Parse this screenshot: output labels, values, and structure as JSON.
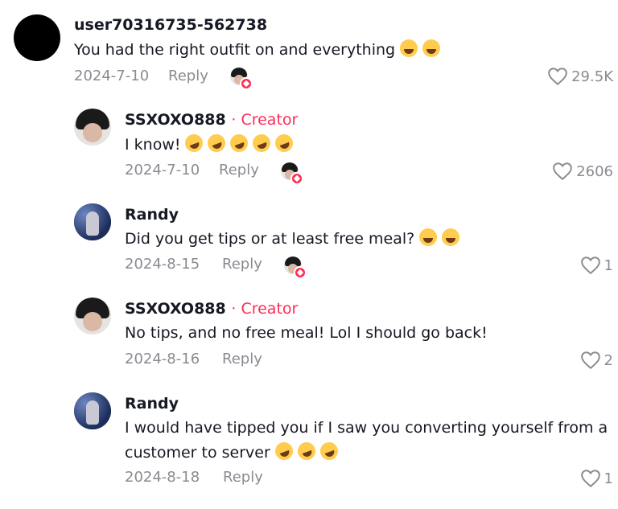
{
  "comments": [
    {
      "username": "user70316735-562738",
      "text": "You had the right outfit on and everything",
      "emoji_count": 2,
      "emoji_icon": "laughing-emoji",
      "date": "2024-7-10",
      "reply_label": "Reply",
      "likes": "29.5K",
      "creator_liked": true
    },
    {
      "username": "SSXOXO888",
      "creator_badge": "· Creator",
      "text": "I know!",
      "emoji_count": 5,
      "emoji_icon": "rofl-emoji",
      "date": "2024-7-10",
      "reply_label": "Reply",
      "likes": "2606",
      "creator_liked": true
    },
    {
      "username": "Randy",
      "text": "Did you get tips or at least free meal?",
      "emoji_count": 2,
      "emoji_icon": "laughing-emoji",
      "date": "2024-8-15",
      "reply_label": "Reply",
      "likes": "1",
      "creator_liked": true
    },
    {
      "username": "SSXOXO888",
      "creator_badge": "· Creator",
      "text": "No tips, and no free meal! Lol I should go back!",
      "date": "2024-8-16",
      "reply_label": "Reply",
      "likes": "2"
    },
    {
      "username": "Randy",
      "text_line1": "I would have tipped you if I saw you converting yourself from a",
      "text_line2": "customer to server",
      "emoji_count": 3,
      "emoji_icon": "rofl-emoji",
      "date": "2024-8-18",
      "reply_label": "Reply",
      "likes": "1"
    }
  ],
  "colors": {
    "accent": "#fe2c55",
    "muted": "#8a8b91",
    "text": "#161823"
  }
}
